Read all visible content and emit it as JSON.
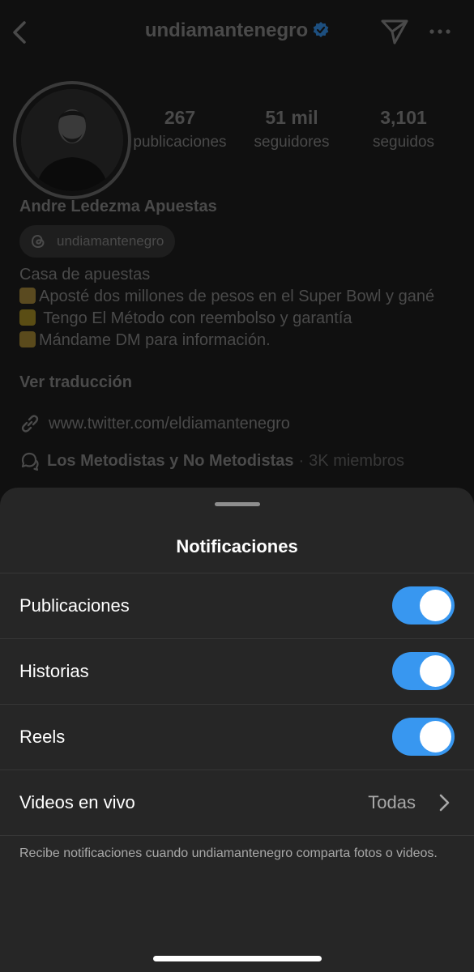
{
  "header": {
    "username": "undiamantenegro"
  },
  "profile": {
    "stats": [
      {
        "value": "267",
        "label": "publicaciones"
      },
      {
        "value": "51 mil",
        "label": "seguidores"
      },
      {
        "value": "3,101",
        "label": "seguidos"
      }
    ],
    "full_name": "Andre Ledezma Apuestas",
    "threads_handle": "undiamantenegro",
    "bio": {
      "category": "Casa de apuestas",
      "line1": "Aposté dos millones de pesos en el Super Bowl y gané",
      "line2": " Tengo El Método con reembolso y garantía",
      "line3": "Mándame DM para información."
    },
    "see_translation": "Ver traducción",
    "link": "www.twitter.com/eldiamantenegro",
    "channel": {
      "name": "Los Metodistas y No Metodistas",
      "separator": "·",
      "members": "3K miembros"
    }
  },
  "sheet": {
    "title": "Notificaciones",
    "options": [
      {
        "label": "Publicaciones",
        "enabled": true
      },
      {
        "label": "Historias",
        "enabled": true
      },
      {
        "label": "Reels",
        "enabled": true
      }
    ],
    "live": {
      "label": "Videos en vivo",
      "value": "Todas"
    },
    "note": "Recibe notificaciones cuando undiamantenegro comparta fotos o videos."
  },
  "colors": {
    "toggle_on": "#3897f0",
    "sheet_bg": "#262626",
    "verified_blue": "#3897f0"
  },
  "icons": [
    "chevron-left-icon",
    "verified-badge-icon",
    "send-icon",
    "more-icon",
    "threads-icon",
    "money-bag-icon",
    "star-icon",
    "victory-hand-icon",
    "link-icon",
    "channel-icon",
    "chevron-right-icon"
  ]
}
